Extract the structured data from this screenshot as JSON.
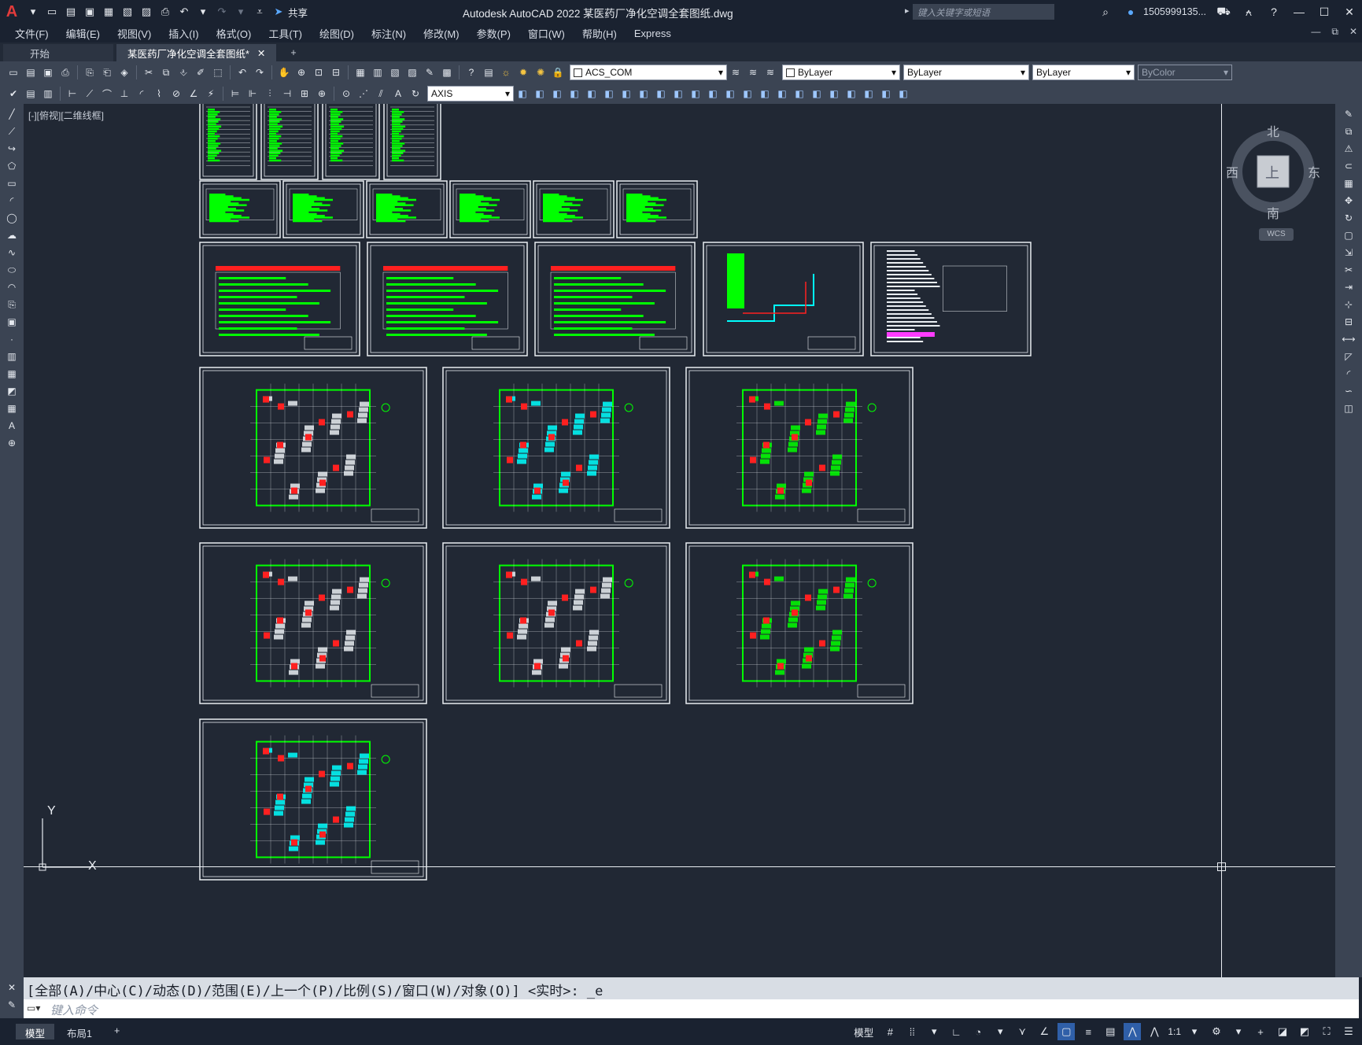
{
  "app": {
    "title": "Autodesk AutoCAD 2022    某医药厂净化空调全套图纸.dwg",
    "logo": "A",
    "share_label": "共享",
    "search_placeholder": "键入关键字或短语",
    "user": "1505999135...",
    "help": "?"
  },
  "menu": {
    "items": [
      "文件(F)",
      "编辑(E)",
      "视图(V)",
      "插入(I)",
      "格式(O)",
      "工具(T)",
      "绘图(D)",
      "标注(N)",
      "修改(M)",
      "参数(P)",
      "窗口(W)",
      "帮助(H)",
      "Express"
    ]
  },
  "tabs": {
    "start": "开始",
    "active": "某医药厂净化空调全套图纸*",
    "close": "✕",
    "add": "+"
  },
  "toolbar": {
    "layer_value": "ACS_COM",
    "color_value": "ByLayer",
    "linetype_value": "ByLayer",
    "lineweight_value": "ByLayer",
    "plotstyle_value": "ByColor",
    "textstyle_value": "AXIS"
  },
  "viewport": {
    "label": "[-][俯视][二维线框]",
    "compass": {
      "north": "北",
      "south": "南",
      "east": "东",
      "west": "西",
      "top": "上",
      "wcs": "WCS"
    },
    "axis_x": "X",
    "axis_y": "Y"
  },
  "command": {
    "history": "[全部(A)/中心(C)/动态(D)/范围(E)/上一个(P)/比例(S)/窗口(W)/对象(O)] <实时>: _e",
    "placeholder": "键入命令"
  },
  "status": {
    "tabs": [
      "模型",
      "布局1"
    ],
    "add": "+",
    "model_label": "模型",
    "scale": "1:1"
  },
  "colors": {
    "accent": "#2f5fa8",
    "drawing_green": "#00ff00",
    "drawing_cyan": "#00ffff",
    "drawing_red": "#ff2020"
  }
}
